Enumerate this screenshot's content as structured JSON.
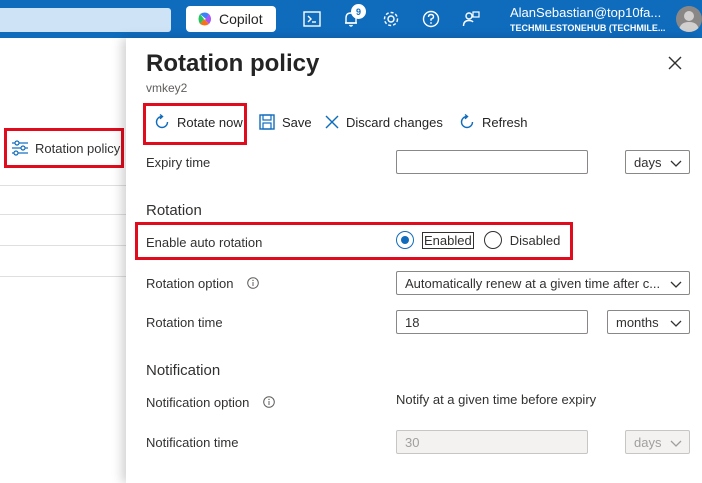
{
  "topbar": {
    "copilot_label": "Copilot",
    "notification_count": "9",
    "account_name": "AlanSebastian@top10fa...",
    "account_tenant": "TECHMILESTONEHUB (TECHMILE...",
    "icons": [
      "cloud-shell-icon",
      "bell-icon",
      "gear-icon",
      "help-icon",
      "feedback-icon"
    ]
  },
  "left_blade": {
    "menu_item_label": "Rotation policy"
  },
  "panel": {
    "title": "Rotation policy",
    "subtitle": "vmkey2",
    "toolbar": {
      "rotate_now": "Rotate now",
      "save": "Save",
      "discard": "Discard changes",
      "refresh": "Refresh"
    },
    "expiry": {
      "label": "Expiry time",
      "value": "",
      "unit": "days"
    },
    "rotation": {
      "section_title": "Rotation",
      "auto_rotation_label": "Enable auto rotation",
      "enabled_label": "Enabled",
      "disabled_label": "Disabled",
      "selected": "Enabled",
      "option_label": "Rotation option",
      "option_value": "Automatically renew at a given time after c...",
      "time_label": "Rotation time",
      "time_value": "18",
      "time_unit": "months"
    },
    "notification": {
      "section_title": "Notification",
      "option_label": "Notification option",
      "option_value": "Notify at a given time before expiry",
      "time_label": "Notification time",
      "time_value": "30",
      "time_unit": "days"
    }
  },
  "colors": {
    "brand_blue": "#0f6cbd",
    "highlight_red": "#e00b1c"
  }
}
